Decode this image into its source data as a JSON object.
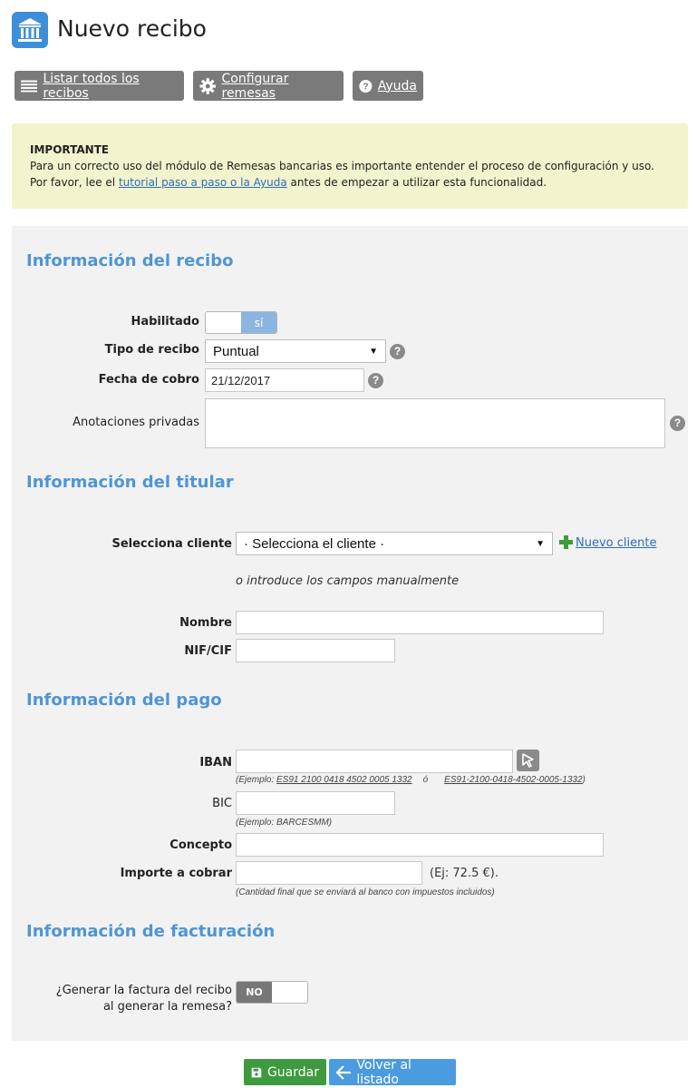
{
  "header": {
    "title": "Nuevo recibo",
    "icon": "bank-icon"
  },
  "toolbar": {
    "list_label": "Listar todos los recibos",
    "config_label": "Configurar remesas",
    "help_label": "Ayuda"
  },
  "notice": {
    "title": "IMPORTANTE",
    "line1": "Para un correcto uso del módulo de Remesas bancarias es importante entender el proceso de configuración y uso.",
    "line2_pre": "Por favor, lee el ",
    "line2_link": "tutorial paso a paso o la Ayuda",
    "line2_post": " antes de empezar a utilizar esta funcionalidad."
  },
  "receipt": {
    "section_title": "Información del recibo",
    "enabled_label": "Habilitado",
    "enabled_value": "sí",
    "type_label": "Tipo de recibo",
    "type_value": "Puntual",
    "date_label": "Fecha de cobro",
    "date_value": "21/12/2017",
    "notes_label": "Anotaciones privadas",
    "notes_value": ""
  },
  "holder": {
    "section_title": "Información del titular",
    "client_label": "Selecciona cliente",
    "client_value": "· Selecciona el cliente ·",
    "new_client_label": "Nuevo cliente",
    "manual_hint": "o introduce los campos manualmente",
    "name_label": "Nombre",
    "name_value": "",
    "nif_label": "NIF/CIF",
    "nif_value": ""
  },
  "payment": {
    "section_title": "Información del pago",
    "iban_label": "IBAN",
    "iban_value": "",
    "iban_hint_pre": "(Ejemplo: ",
    "iban_example1": "ES91 2100 0418 4502 0005 1332",
    "iban_hint_or": "ó",
    "iban_example2": "ES91-2100-0418-4502-0005-1332",
    "iban_hint_post": ")",
    "bic_label": "BIC",
    "bic_value": "",
    "bic_hint": "(Ejemplo: BARCESMM)",
    "concept_label": "Concepto",
    "concept_value": "",
    "amount_label": "Importe a cobrar",
    "amount_value": "",
    "amount_example": "(Ej: 72.5 €).",
    "amount_hint": "(Cantidad final que se enviará al banco con impuestos incluidos)"
  },
  "billing": {
    "section_title": "Información de facturación",
    "invoice_label_line1": "¿Generar la factura del recibo",
    "invoice_label_line2": "al generar la remesa?",
    "invoice_value": "NO"
  },
  "actions": {
    "save_label": "Guardar",
    "back_label": "Volver al listado"
  },
  "colors": {
    "accent": "#4f95d5",
    "save": "#3e9a3e",
    "back": "#4a9be0",
    "notice_bg": "#f3f3cd",
    "toolbar_btn": "#7a7a7a"
  }
}
